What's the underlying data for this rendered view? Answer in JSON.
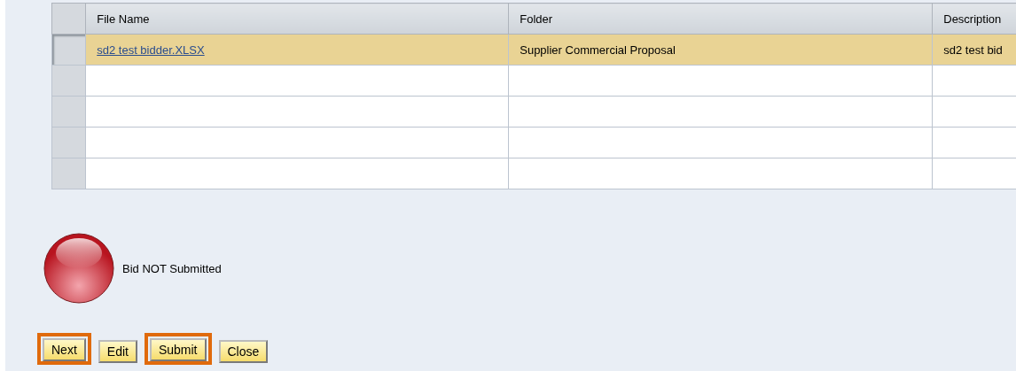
{
  "table": {
    "columns": [
      "File Name",
      "Folder",
      "Description"
    ],
    "rows": [
      {
        "selected": true,
        "cells": [
          "sd2 test bidder.XLSX",
          "Supplier Commercial Proposal",
          "sd2 test bid"
        ]
      },
      {
        "selected": false,
        "cells": []
      },
      {
        "selected": false,
        "cells": []
      },
      {
        "selected": false,
        "cells": []
      },
      {
        "selected": false,
        "cells": []
      }
    ]
  },
  "status": {
    "kind": "error",
    "label": "Bid NOT Submitted"
  },
  "buttons": [
    {
      "label": "Next",
      "highlighted": true
    },
    {
      "label": "Edit",
      "highlighted": false
    },
    {
      "label": "Submit",
      "highlighted": true
    },
    {
      "label": "Close",
      "highlighted": false
    }
  ]
}
